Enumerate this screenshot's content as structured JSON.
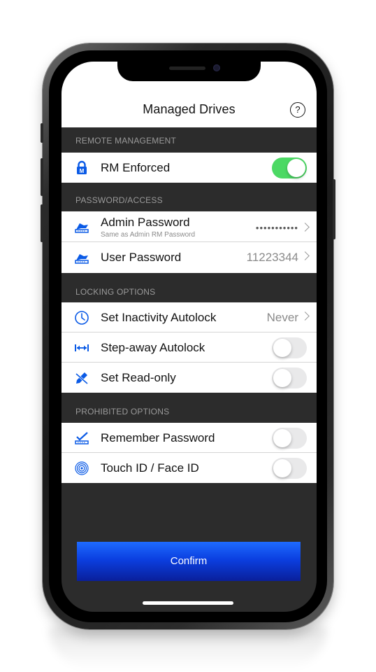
{
  "nav": {
    "title": "Managed Drives",
    "help_label": "?"
  },
  "sections": {
    "remote_management": "REMOTE MANAGEMENT",
    "password_access": "PASSWORD/ACCESS",
    "locking_options": "LOCKING OPTIONS",
    "prohibited_options": "PROHIBITED OPTIONS"
  },
  "rows": {
    "rm_enforced": {
      "label": "RM Enforced",
      "icon": "lock-icon",
      "toggle_on": true
    },
    "admin_password": {
      "label": "Admin Password",
      "sublabel": "Same as Admin RM Password",
      "value": "•••••••••••",
      "icon": "drive-key-icon"
    },
    "user_password": {
      "label": "User Password",
      "value": "11223344",
      "icon": "drive-key-icon"
    },
    "inactivity_autolock": {
      "label": "Set Inactivity Autolock",
      "value": "Never",
      "icon": "clock-icon"
    },
    "stepaway_autolock": {
      "label": "Step-away Autolock",
      "icon": "arrows-horizontal-icon",
      "toggle_on": false
    },
    "read_only": {
      "label": "Set Read-only",
      "icon": "pencil-slash-icon",
      "toggle_on": false
    },
    "remember_password": {
      "label": "Remember Password",
      "icon": "drive-check-icon",
      "toggle_on": false
    },
    "touch_face_id": {
      "label": "Touch ID / Face ID",
      "icon": "fingerprint-icon",
      "toggle_on": false
    }
  },
  "confirm_label": "Confirm",
  "colors": {
    "accent": "#0a5ae6",
    "toggle_on": "#4cd964",
    "section_bg": "#2c2c2c",
    "confirm_top": "#1e6bff",
    "confirm_bottom": "#0a1f9a"
  }
}
